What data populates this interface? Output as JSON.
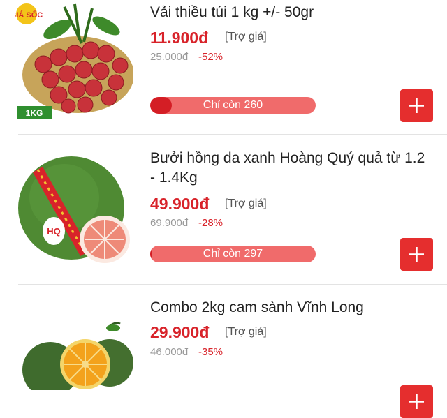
{
  "products": [
    {
      "name": "Vải thiều túi 1 kg +/- 50gr",
      "price": "11.900đ",
      "subsidy": "[Trợ giá]",
      "old_price": "25.000đ",
      "discount": "-52%",
      "stock_label": "Chỉ còn 260",
      "stock_fill_fraction": 0.13,
      "image_badge_top": "GIÁ SỐC",
      "image_badge_weight": "1KG"
    },
    {
      "name": "Bưởi hồng da xanh Hoàng Quý quả từ 1.2 - 1.4Kg",
      "price": "49.900đ",
      "subsidy": "[Trợ giá]",
      "old_price": "69.900đ",
      "discount": "-28%",
      "stock_label": "Chỉ còn 297",
      "stock_fill_fraction": 0.01,
      "image_label": "HQ"
    },
    {
      "name": "Combo 2kg cam sành Vĩnh Long",
      "price": "29.900đ",
      "subsidy": "[Trợ giá]",
      "old_price": "46.000đ",
      "discount": "-35%"
    }
  ],
  "icons": {
    "add": "plus-icon"
  },
  "colors": {
    "accent": "#d8232a",
    "button": "#e52e2e",
    "bar": "#f06b6b",
    "bar_fill": "#d41e25"
  }
}
